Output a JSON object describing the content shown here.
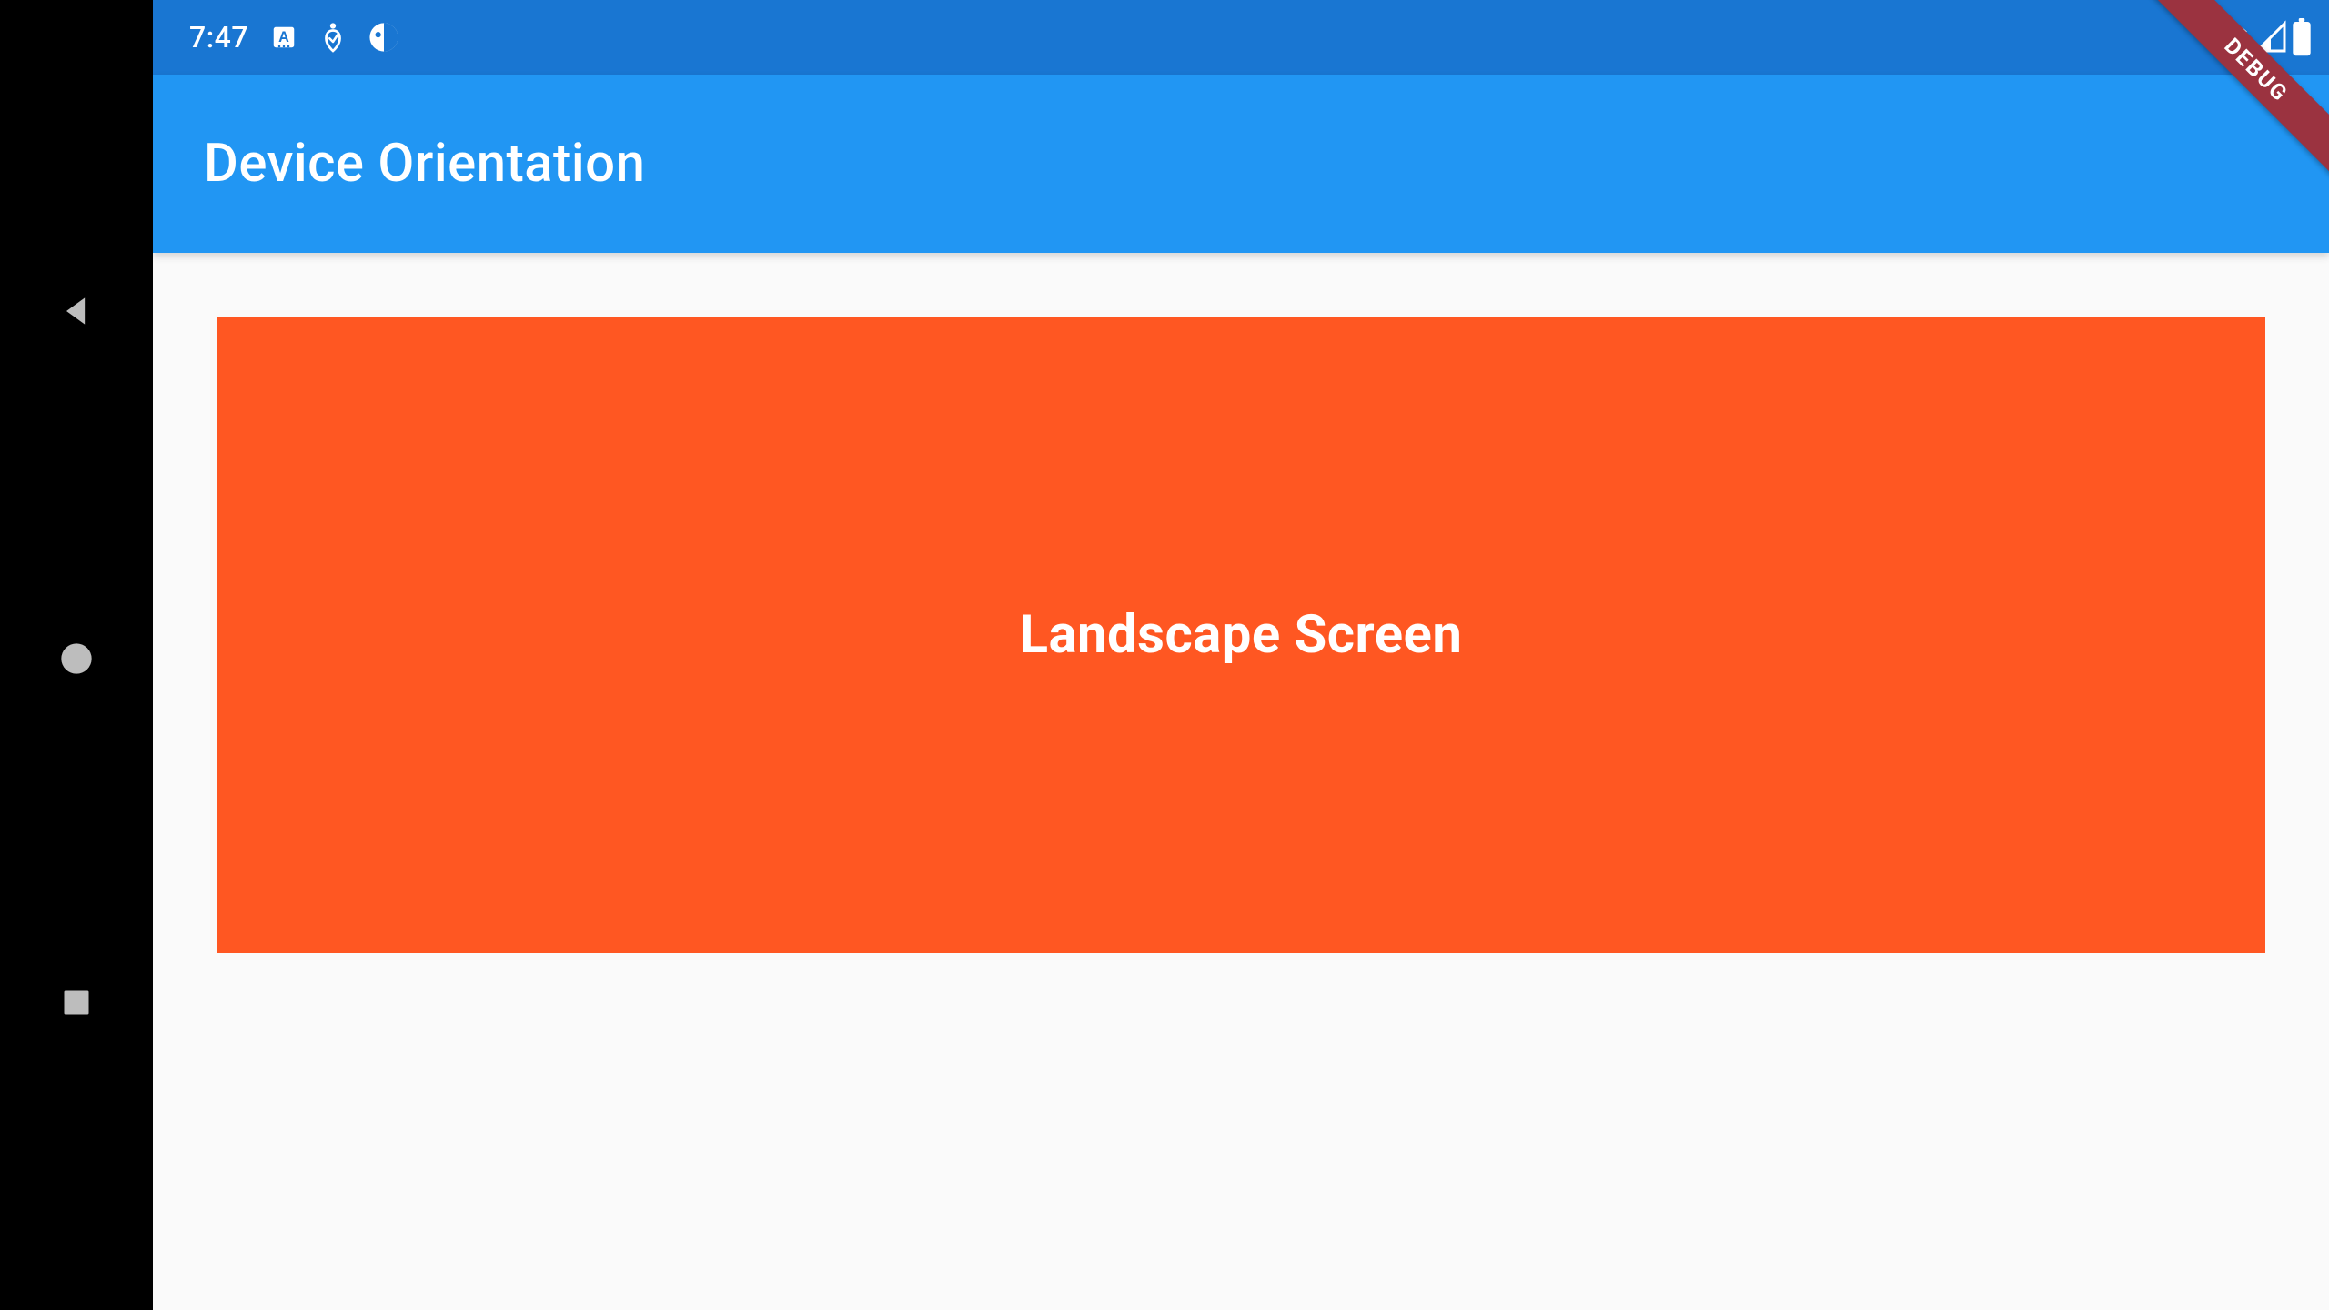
{
  "status_bar": {
    "time": "7:47"
  },
  "app_bar": {
    "title": "Device Orientation"
  },
  "content": {
    "box_label": "Landscape Screen"
  },
  "debug": {
    "label": "DEBUG"
  }
}
